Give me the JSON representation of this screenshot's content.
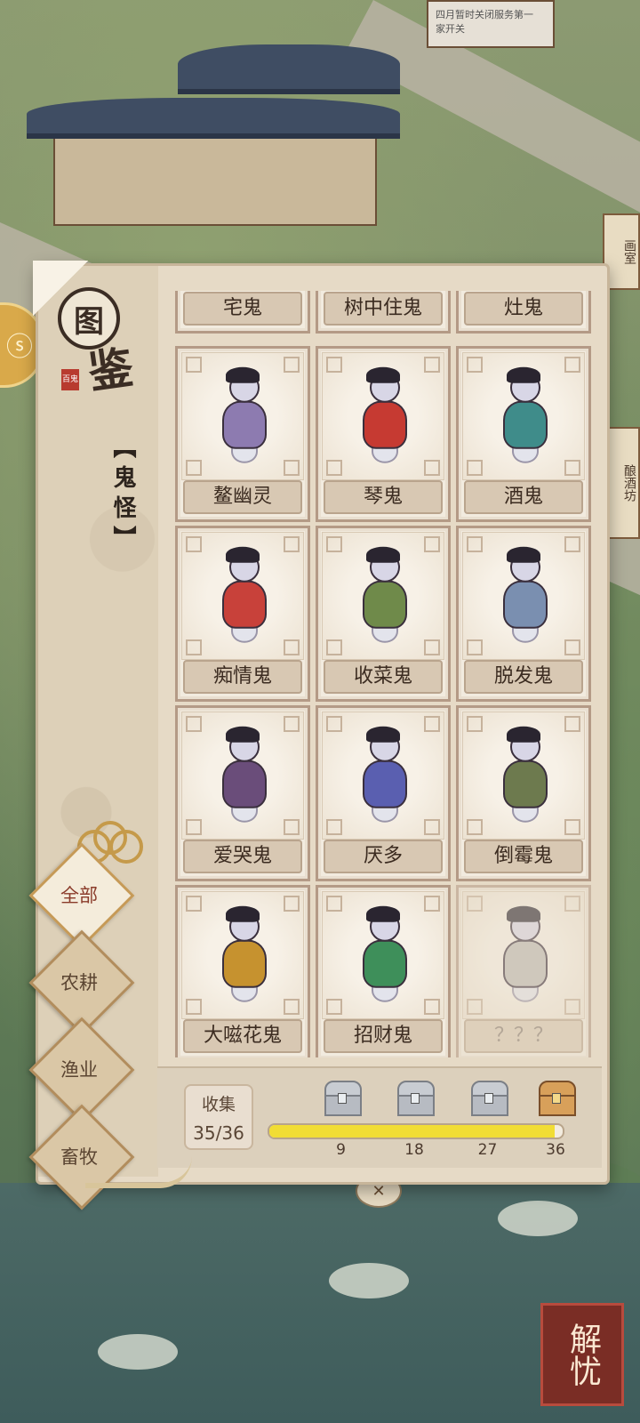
{
  "category": {
    "title": "【鬼怪】"
  },
  "logo": {
    "char1": "图",
    "char2": "鉴",
    "seal": "百鬼"
  },
  "filters": [
    {
      "label": "全部",
      "active": true
    },
    {
      "label": "农耕",
      "active": false
    },
    {
      "label": "渔业",
      "active": false
    },
    {
      "label": "畜牧",
      "active": false
    }
  ],
  "partial_row": [
    "宅鬼",
    "树中住鬼",
    "灶鬼"
  ],
  "cards": [
    {
      "name": "鳌幽灵",
      "locked": false,
      "color": "#8d7bb0"
    },
    {
      "name": "琴鬼",
      "locked": false,
      "color": "#c63a32"
    },
    {
      "name": "酒鬼",
      "locked": false,
      "color": "#3f8c8a"
    },
    {
      "name": "痴情鬼",
      "locked": false,
      "color": "#c8413a"
    },
    {
      "name": "收菜鬼",
      "locked": false,
      "color": "#6f8a4a"
    },
    {
      "name": "脱发鬼",
      "locked": false,
      "color": "#7a8fb0"
    },
    {
      "name": "爱哭鬼",
      "locked": false,
      "color": "#6a4d7a"
    },
    {
      "name": "厌多",
      "locked": false,
      "color": "#5a5fb0"
    },
    {
      "name": "倒霉鬼",
      "locked": false,
      "color": "#6d7a4e"
    },
    {
      "name": "大嗞花鬼",
      "locked": false,
      "color": "#c6922f"
    },
    {
      "name": "招财鬼",
      "locked": false,
      "color": "#3e8f5a"
    },
    {
      "name": "？？？",
      "locked": true,
      "color": "#bdbab4"
    }
  ],
  "collection": {
    "label": "收集",
    "count_text": "35/36",
    "progress": 0.972,
    "milestones": [
      {
        "value": "9",
        "frac": 0.25,
        "gold": false
      },
      {
        "value": "18",
        "frac": 0.5,
        "gold": false
      },
      {
        "value": "27",
        "frac": 0.75,
        "gold": false
      },
      {
        "value": "36",
        "frac": 1.0,
        "gold": true
      }
    ]
  },
  "scene": {
    "corner_button": "解忧",
    "right_tags": [
      "画室",
      "酿酒坊"
    ],
    "sign_text": "四月暂时关闭服务第一家开关"
  }
}
